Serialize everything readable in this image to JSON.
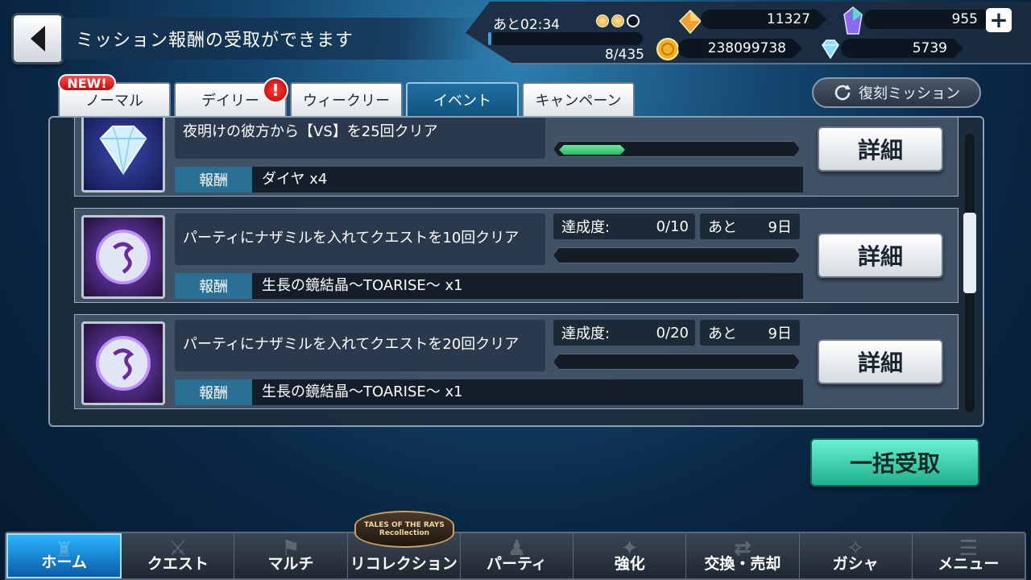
{
  "header": {
    "title": "ミッション報酬の受取ができます"
  },
  "status": {
    "stamina_timer": "あと02:34",
    "stamina_value": "8/435",
    "stamina_fraction": 0.0184,
    "gald": "11327",
    "crystals": "955",
    "coins": "238099738",
    "diamonds": "5739"
  },
  "tabs": [
    {
      "label": "ノーマル",
      "active": false
    },
    {
      "label": "デイリー",
      "active": false
    },
    {
      "label": "ウィークリー",
      "active": false
    },
    {
      "label": "イベント",
      "active": true
    },
    {
      "label": "キャンペーン",
      "active": false
    }
  ],
  "badges": {
    "new": "NEW!",
    "alert": "!"
  },
  "revival_button": "復刻ミッション",
  "missions": [
    {
      "description": "夜明けの彼方から【VS】を25回クリア",
      "reward_label": "報酬",
      "reward": "ダイヤ x4",
      "progress_fraction": 0.28,
      "detail": "詳細"
    },
    {
      "description": "パーティにナザミルを入れてクエストを10回クリア",
      "progress_label": "達成度:",
      "progress": "0/10",
      "remain_label": "あと",
      "remain": "9日",
      "reward_label": "報酬",
      "reward": "生長の鏡結晶〜TOARISE〜 x1",
      "progress_fraction": 0,
      "detail": "詳細"
    },
    {
      "description": "パーティにナザミルを入れてクエストを20回クリア",
      "progress_label": "達成度:",
      "progress": "0/20",
      "remain_label": "あと",
      "remain": "9日",
      "reward_label": "報酬",
      "reward": "生長の鏡結晶〜TOARISE〜 x1",
      "progress_fraction": 0,
      "detail": "詳細"
    }
  ],
  "bulk_receive": "一括受取",
  "nav": [
    {
      "label": "ホーム",
      "active": true
    },
    {
      "label": "クエスト",
      "active": false
    },
    {
      "label": "マルチ",
      "active": false
    },
    {
      "label": "リコレクション",
      "active": false
    },
    {
      "label": "パーティ",
      "active": false
    },
    {
      "label": "強化",
      "active": false
    },
    {
      "label": "交換・売却",
      "active": false
    },
    {
      "label": "ガシャ",
      "active": false
    },
    {
      "label": "メニュー",
      "active": false
    }
  ],
  "logo_text": "TALES OF THE RAYS Recollection",
  "colors": {
    "active_tab": "#1e6fa0",
    "progress_fill": "#2fb868",
    "bulk_button": "#1fb08c",
    "nav_active": "#2ab4ff",
    "alert_red": "#d41414"
  }
}
